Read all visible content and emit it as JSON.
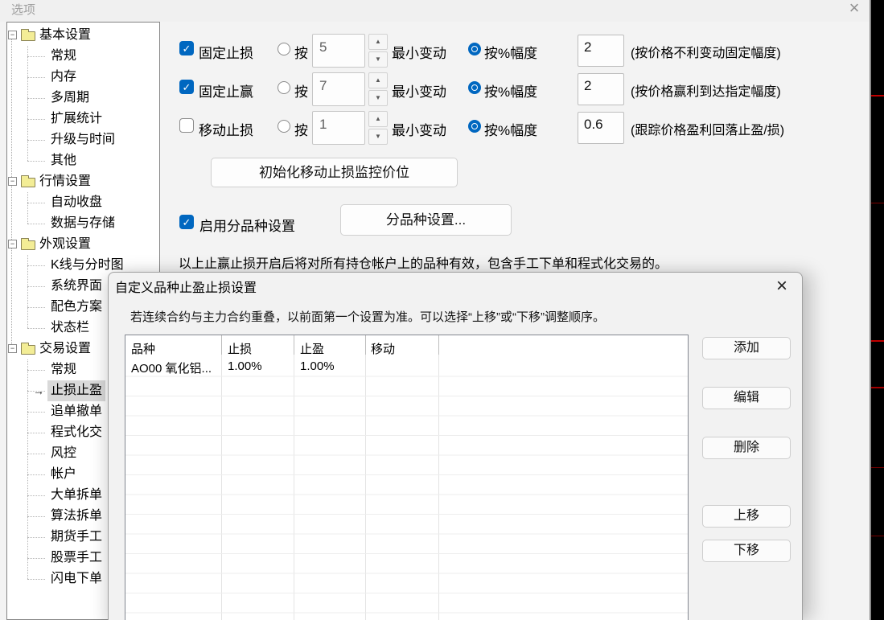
{
  "window": {
    "title": "选项"
  },
  "icons": {
    "close": "×",
    "check": "✓",
    "spin_up": "▲",
    "spin_down": "▼",
    "selected_arrow": "→",
    "expander_minus": "−"
  },
  "tree": {
    "groups": [
      {
        "label": "基本设置",
        "children": [
          "常规",
          "内存",
          "多周期",
          "扩展统计",
          "升级与时间",
          "其他"
        ]
      },
      {
        "label": "行情设置",
        "children": [
          "自动收盘",
          "数据与存储"
        ]
      },
      {
        "label": "外观设置",
        "children": [
          "K线与分时图",
          "系统界面",
          "配色方案",
          "状态栏"
        ]
      },
      {
        "label": "交易设置",
        "children": [
          "常规",
          "止损止盈",
          "追单撤单",
          "程式化交",
          "风控",
          "帐户",
          "大单拆单",
          "算法拆单",
          "期货手工",
          "股票手工",
          "闪电下单"
        ],
        "selected_child": "止损止盈"
      }
    ]
  },
  "panel": {
    "rows": [
      {
        "checkbox_label": "固定止损",
        "checked": true,
        "radio_abs_label": "按",
        "abs_value": "5",
        "min_change_label": "最小变动",
        "radio_pct_label": "按%幅度",
        "pct_checked": true,
        "pct_value": "2",
        "note": "(按价格不利变动固定幅度)"
      },
      {
        "checkbox_label": "固定止赢",
        "checked": true,
        "radio_abs_label": "按",
        "abs_value": "7",
        "min_change_label": "最小变动",
        "radio_pct_label": "按%幅度",
        "pct_checked": true,
        "pct_value": "2",
        "note": "(按价格赢利到达指定幅度)"
      },
      {
        "checkbox_label": "移动止损",
        "checked": false,
        "radio_abs_label": "按",
        "abs_value": "1",
        "min_change_label": "最小变动",
        "radio_pct_label": "按%幅度",
        "pct_checked": true,
        "pct_value": "0.6",
        "note": "(跟踪价格盈利回落止盈/损)"
      }
    ],
    "init_button": "初始化移动止损监控价位",
    "enable_checkbox_label": "启用分品种设置",
    "enable_checked": true,
    "per_symbol_button": "分品种设置...",
    "footer_note": "以上止赢止损开启后将对所有持仓帐户上的品种有效，包含手工下单和程式化交易的。"
  },
  "modal": {
    "title": "自定义品种止盈止损设置",
    "hint": "若连续合约与主力合约重叠，以前面第一个设置为准。可以选择“上移”或“下移”调整顺序。",
    "table": {
      "headers": [
        "品种",
        "止损",
        "止盈",
        "移动"
      ],
      "rows": [
        {
          "symbol": "AO00 氧化铝...",
          "stop_loss": "1.00%",
          "stop_profit": "1.00%",
          "trailing": ""
        }
      ]
    },
    "buttons": [
      "添加",
      "编辑",
      "删除",
      "上移",
      "下移"
    ],
    "accent_color": "#0067c0"
  }
}
